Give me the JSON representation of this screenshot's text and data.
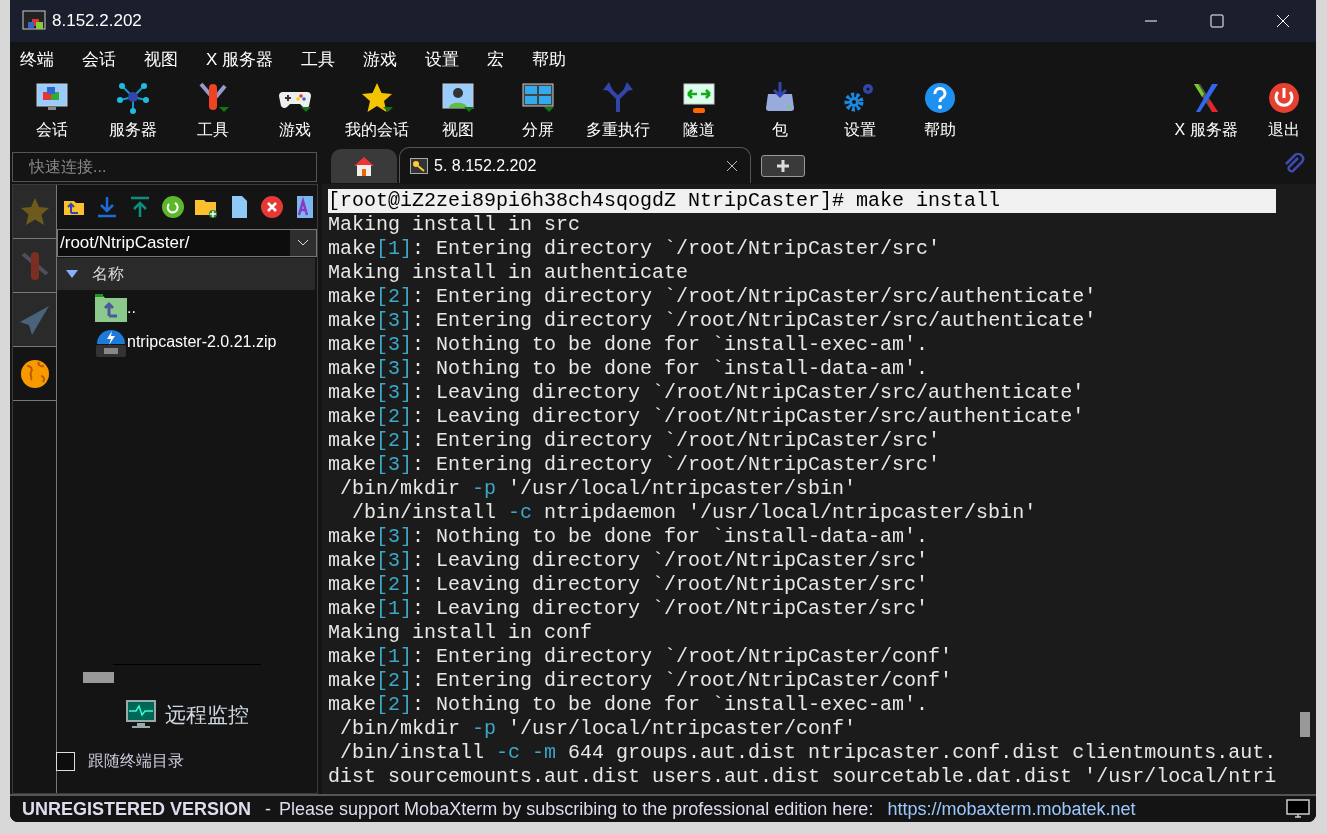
{
  "window": {
    "title": "8.152.2.202"
  },
  "menu": [
    "终端",
    "会话",
    "视图",
    "X 服务器",
    "工具",
    "游戏",
    "设置",
    "宏",
    "帮助"
  ],
  "toolbar": [
    "会话",
    "服务器",
    "工具",
    "游戏",
    "我的会话",
    "视图",
    "分屏",
    "多重执行",
    "隧道",
    "包",
    "设置",
    "帮助"
  ],
  "toolbar_right": [
    "X 服务器",
    "退出"
  ],
  "quick_connect": {
    "placeholder": "快速连接..."
  },
  "tabs": [
    {
      "kind": "home",
      "selected": false
    },
    {
      "kind": "session",
      "label": "5. 8.152.2.202",
      "selected": true
    },
    {
      "kind": "new",
      "selected": false
    }
  ],
  "side_tabs": [
    {
      "selected": false
    },
    {
      "selected": false
    },
    {
      "selected": false
    },
    {
      "selected": true
    }
  ],
  "file_browser": {
    "path": "/root/NtripCaster/",
    "column": "名称",
    "files": [
      {
        "kind": "parent",
        "name": ".."
      },
      {
        "kind": "zip",
        "name": "ntripcaster-2.0.21.zip"
      }
    ],
    "monitor": "远程监控",
    "follow": {
      "label": "跟随终端目录",
      "checked": false
    }
  },
  "terminal": [
    {
      "highlighted": true,
      "segments": [
        {
          "text": "[root@iZ2zei89pi6h38ch4sqogdZ NtripCaster]# make install",
          "kind": "plain"
        }
      ]
    },
    {
      "highlighted": false,
      "segments": [
        {
          "text": "Making install in src",
          "kind": "plain"
        }
      ]
    },
    {
      "highlighted": false,
      "segments": [
        {
          "text": "make",
          "kind": "plain"
        },
        {
          "text": "[1]",
          "kind": "accent"
        },
        {
          "text": ": Entering directory `/root/NtripCaster/src'",
          "kind": "plain"
        }
      ]
    },
    {
      "highlighted": false,
      "segments": [
        {
          "text": "Making install in authenticate",
          "kind": "plain"
        }
      ]
    },
    {
      "highlighted": false,
      "segments": [
        {
          "text": "make",
          "kind": "plain"
        },
        {
          "text": "[2]",
          "kind": "accent"
        },
        {
          "text": ": Entering directory `/root/NtripCaster/src/authenticate'",
          "kind": "plain"
        }
      ]
    },
    {
      "highlighted": false,
      "segments": [
        {
          "text": "make",
          "kind": "plain"
        },
        {
          "text": "[3]",
          "kind": "accent"
        },
        {
          "text": ": Entering directory `/root/NtripCaster/src/authenticate'",
          "kind": "plain"
        }
      ]
    },
    {
      "highlighted": false,
      "segments": [
        {
          "text": "make",
          "kind": "plain"
        },
        {
          "text": "[3]",
          "kind": "accent"
        },
        {
          "text": ": Nothing to be done for `install-exec-am'.",
          "kind": "plain"
        }
      ]
    },
    {
      "highlighted": false,
      "segments": [
        {
          "text": "make",
          "kind": "plain"
        },
        {
          "text": "[3]",
          "kind": "accent"
        },
        {
          "text": ": Nothing to be done for `install-data-am'.",
          "kind": "plain"
        }
      ]
    },
    {
      "highlighted": false,
      "segments": [
        {
          "text": "make",
          "kind": "plain"
        },
        {
          "text": "[3]",
          "kind": "accent"
        },
        {
          "text": ": Leaving directory `/root/NtripCaster/src/authenticate'",
          "kind": "plain"
        }
      ]
    },
    {
      "highlighted": false,
      "segments": [
        {
          "text": "make",
          "kind": "plain"
        },
        {
          "text": "[2]",
          "kind": "accent"
        },
        {
          "text": ": Leaving directory `/root/NtripCaster/src/authenticate'",
          "kind": "plain"
        }
      ]
    },
    {
      "highlighted": false,
      "segments": [
        {
          "text": "make",
          "kind": "plain"
        },
        {
          "text": "[2]",
          "kind": "accent"
        },
        {
          "text": ": Entering directory `/root/NtripCaster/src'",
          "kind": "plain"
        }
      ]
    },
    {
      "highlighted": false,
      "segments": [
        {
          "text": "make",
          "kind": "plain"
        },
        {
          "text": "[3]",
          "kind": "accent"
        },
        {
          "text": ": Entering directory `/root/NtripCaster/src'",
          "kind": "plain"
        }
      ]
    },
    {
      "highlighted": false,
      "segments": [
        {
          "text": " /bin/mkdir ",
          "kind": "plain"
        },
        {
          "text": "-p",
          "kind": "accent"
        },
        {
          "text": " '/usr/local/ntripcaster/sbin'",
          "kind": "plain"
        }
      ]
    },
    {
      "highlighted": false,
      "segments": [
        {
          "text": "  /bin/install ",
          "kind": "plain"
        },
        {
          "text": "-c",
          "kind": "accent"
        },
        {
          "text": " ntripdaemon '/usr/local/ntripcaster/sbin'",
          "kind": "plain"
        }
      ]
    },
    {
      "highlighted": false,
      "segments": [
        {
          "text": "make",
          "kind": "plain"
        },
        {
          "text": "[3]",
          "kind": "accent"
        },
        {
          "text": ": Nothing to be done for `install-data-am'.",
          "kind": "plain"
        }
      ]
    },
    {
      "highlighted": false,
      "segments": [
        {
          "text": "make",
          "kind": "plain"
        },
        {
          "text": "[3]",
          "kind": "accent"
        },
        {
          "text": ": Leaving directory `/root/NtripCaster/src'",
          "kind": "plain"
        }
      ]
    },
    {
      "highlighted": false,
      "segments": [
        {
          "text": "make",
          "kind": "plain"
        },
        {
          "text": "[2]",
          "kind": "accent"
        },
        {
          "text": ": Leaving directory `/root/NtripCaster/src'",
          "kind": "plain"
        }
      ]
    },
    {
      "highlighted": false,
      "segments": [
        {
          "text": "make",
          "kind": "plain"
        },
        {
          "text": "[1]",
          "kind": "accent"
        },
        {
          "text": ": Leaving directory `/root/NtripCaster/src'",
          "kind": "plain"
        }
      ]
    },
    {
      "highlighted": false,
      "segments": [
        {
          "text": "Making install in conf",
          "kind": "plain"
        }
      ]
    },
    {
      "highlighted": false,
      "segments": [
        {
          "text": "make",
          "kind": "plain"
        },
        {
          "text": "[1]",
          "kind": "accent"
        },
        {
          "text": ": Entering directory `/root/NtripCaster/conf'",
          "kind": "plain"
        }
      ]
    },
    {
      "highlighted": false,
      "segments": [
        {
          "text": "make",
          "kind": "plain"
        },
        {
          "text": "[2]",
          "kind": "accent"
        },
        {
          "text": ": Entering directory `/root/NtripCaster/conf'",
          "kind": "plain"
        }
      ]
    },
    {
      "highlighted": false,
      "segments": [
        {
          "text": "make",
          "kind": "plain"
        },
        {
          "text": "[2]",
          "kind": "accent"
        },
        {
          "text": ": Nothing to be done for `install-exec-am'.",
          "kind": "plain"
        }
      ]
    },
    {
      "highlighted": false,
      "segments": [
        {
          "text": " /bin/mkdir ",
          "kind": "plain"
        },
        {
          "text": "-p",
          "kind": "accent"
        },
        {
          "text": " '/usr/local/ntripcaster/conf'",
          "kind": "plain"
        }
      ]
    },
    {
      "highlighted": false,
      "segments": [
        {
          "text": " /bin/install ",
          "kind": "plain"
        },
        {
          "text": "-c",
          "kind": "accent"
        },
        {
          "text": " -m",
          "kind": "accent"
        },
        {
          "text": " 644 groups.aut.dist ntripcaster.conf.dist clientmounts.aut.",
          "kind": "plain"
        }
      ]
    },
    {
      "highlighted": false,
      "segments": [
        {
          "text": "dist sourcemounts.aut.dist users.aut.dist sourcetable.dat.dist '/usr/local/ntri",
          "kind": "plain"
        }
      ]
    }
  ],
  "status_bar": {
    "title": "UNREGISTERED VERSION",
    "separator": "-",
    "message": "Please support MobaXterm by subscribing to the professional edition here:",
    "link": "https://mobaxterm.mobatek.net"
  }
}
